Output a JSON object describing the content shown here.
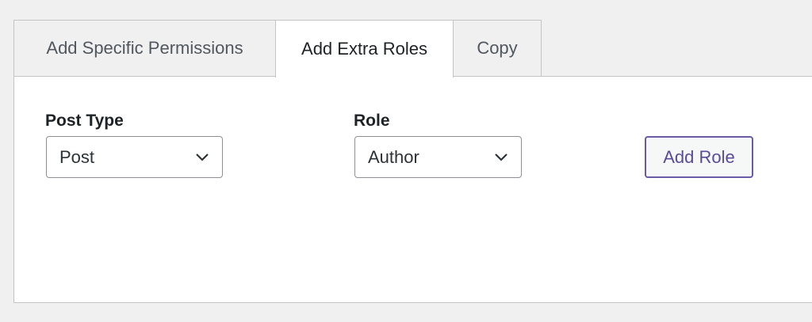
{
  "tabs": [
    {
      "label": "Add Specific Permissions",
      "active": false
    },
    {
      "label": "Add Extra Roles",
      "active": true
    },
    {
      "label": "Copy",
      "active": false
    }
  ],
  "form": {
    "post_type": {
      "label": "Post Type",
      "value": "Post"
    },
    "role": {
      "label": "Role",
      "value": "Author"
    },
    "add_role_label": "Add Role"
  },
  "colors": {
    "accent": "#5b4a9a",
    "border": "#c3c4c7",
    "background": "#f0f0f1"
  }
}
